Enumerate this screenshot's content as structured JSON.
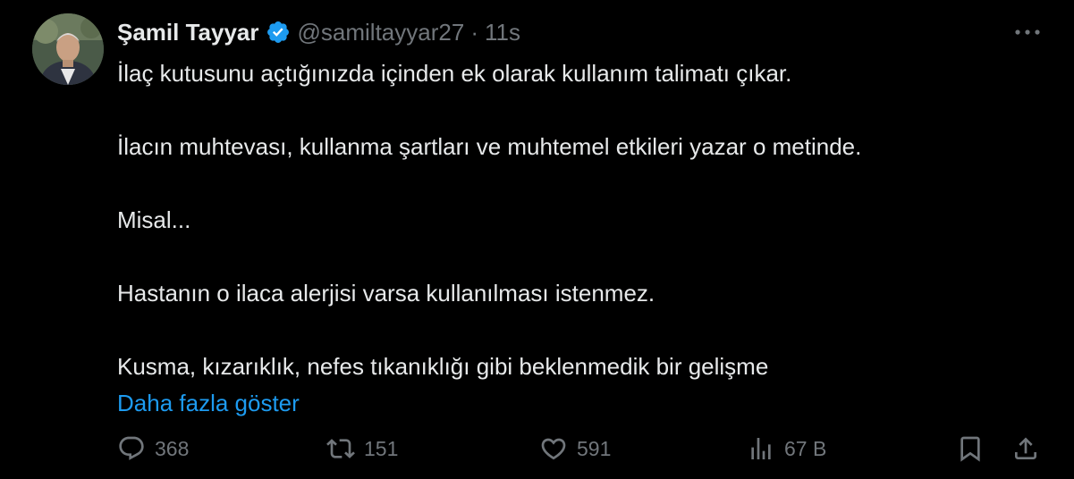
{
  "author": {
    "display_name": "Şamil Tayyar",
    "handle": "@samiltayyar27",
    "separator": "·",
    "time": "11s",
    "verified": true,
    "verified_color": "#1d9bf0"
  },
  "tweet": {
    "lines": [
      "İlaç kutusunu açtığınızda içinden ek olarak kullanım talimatı çıkar.",
      "İlacın muhtevası, kullanma şartları ve muhtemel etkileri yazar o metinde.",
      "Misal...",
      "Hastanın o ilaca alerjisi varsa kullanılması istenmez.",
      "Kusma, kızarıklık, nefes tıkanıklığı gibi beklenmedik bir gelişme"
    ],
    "show_more": "Daha fazla göster"
  },
  "actions": {
    "replies": "368",
    "retweets": "151",
    "likes": "591",
    "views": "67 B"
  },
  "icons": {
    "more": "more-horizontal-icon",
    "reply": "reply-icon",
    "retweet": "retweet-icon",
    "like": "heart-icon",
    "views": "views-icon",
    "bookmark": "bookmark-icon",
    "share": "share-icon"
  },
  "colors": {
    "background": "#000000",
    "text": "#e7e9ea",
    "muted": "#71767b",
    "link": "#1d9bf0"
  }
}
